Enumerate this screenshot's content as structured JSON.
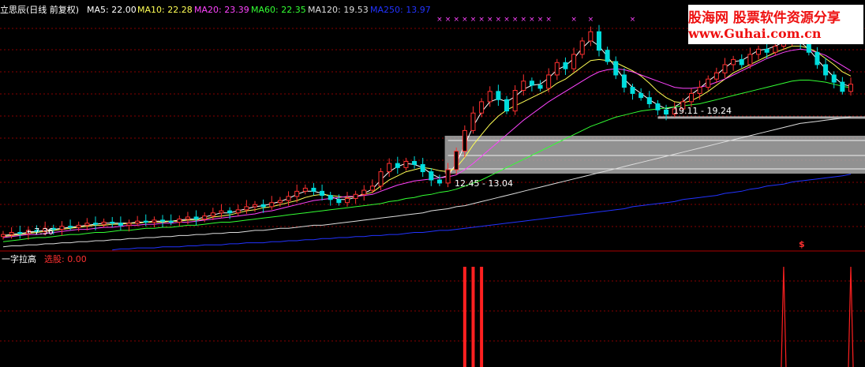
{
  "header": {
    "stock_name": "立思辰(日线 前复权)",
    "ma_labels": [
      {
        "label": "MA5: 22.00",
        "color": "#ffffff"
      },
      {
        "label": "MA10: 22.28",
        "color": "#ffff55"
      },
      {
        "label": "MA20: 23.39",
        "color": "#ff44ff"
      },
      {
        "label": "MA60: 22.35",
        "color": "#33ff33"
      },
      {
        "label": "MA120: 19.53",
        "color": "#dddddd"
      },
      {
        "label": "MA250: 13.97",
        "color": "#2233ff"
      }
    ]
  },
  "annotations": {
    "price_low_label": "←7.36",
    "zone_label_1": "12.45 - 13.04",
    "zone_label_2": "19.11 - 19.24",
    "dollar_sign": "$"
  },
  "indicator_panel": {
    "name": "一字拉高",
    "metric_label": "选股: 0.00"
  },
  "watermark": {
    "line1": "股海网 股票软件资源分享",
    "line2": "www.Guhai.com.cn"
  },
  "colors": {
    "background": "#000000",
    "grid": "#880000",
    "up_candle": "#ff3030",
    "down_candle": "#00dddd",
    "signal_bar": "#ff2020",
    "ma5": "#ffffff",
    "ma10": "#ffff55",
    "ma20": "#ff44ff",
    "ma60": "#33ff33",
    "ma120": "#dddddd",
    "ma250": "#2233ff",
    "zone": "#aaaaaa",
    "marker": "#ff44ff"
  },
  "chart_data": {
    "type": "candlestick",
    "price_range": [
      6.5,
      29.5
    ],
    "close": [
      8.1,
      8.3,
      8.2,
      8.5,
      8.4,
      8.7,
      8.6,
      8.9,
      8.8,
      9.0,
      9.2,
      9.1,
      9.3,
      9.2,
      9.0,
      9.2,
      9.4,
      9.3,
      9.5,
      9.4,
      9.3,
      9.6,
      9.8,
      9.6,
      9.9,
      10.2,
      10.4,
      10.2,
      10.5,
      10.8,
      11.0,
      10.8,
      11.2,
      11.4,
      11.8,
      12.3,
      12.6,
      12.3,
      11.9,
      11.5,
      11.2,
      11.6,
      12.0,
      12.4,
      12.8,
      14.2,
      15.0,
      14.6,
      15.2,
      14.9,
      14.2,
      13.4,
      13.1,
      14.4,
      16.2,
      18.2,
      19.9,
      21.0,
      22.0,
      21.2,
      20.1,
      22.1,
      23.0,
      22.6,
      22.3,
      23.6,
      24.8,
      24.2,
      25.6,
      26.9,
      27.8,
      26.0,
      24.9,
      23.6,
      22.4,
      21.8,
      21.4,
      20.8,
      20.2,
      19.8,
      20.3,
      21.0,
      21.8,
      22.4,
      23.2,
      23.8,
      24.6,
      25.1,
      24.6,
      25.6,
      26.1,
      25.8,
      26.4,
      26.9,
      27.4,
      26.7,
      25.8,
      24.6,
      23.6,
      22.9,
      22.0,
      22.7
    ],
    "series": [
      {
        "name": "MA5",
        "color": "#ffffff",
        "values": [
          8.0,
          8.1,
          8.2,
          8.3,
          8.4,
          8.5,
          8.6,
          8.7,
          8.8,
          8.9,
          9.0,
          9.1,
          9.2,
          9.2,
          9.2,
          9.2,
          9.3,
          9.3,
          9.4,
          9.4,
          9.4,
          9.5,
          9.6,
          9.6,
          9.8,
          10.0,
          10.2,
          10.2,
          10.4,
          10.6,
          10.8,
          10.9,
          11.1,
          11.3,
          11.6,
          12.0,
          12.3,
          12.3,
          12.1,
          11.8,
          11.5,
          11.5,
          11.7,
          12.1,
          12.5,
          13.4,
          14.2,
          14.7,
          15.0,
          14.9,
          14.6,
          14.0,
          13.6,
          13.8,
          15.0,
          16.8,
          18.6,
          20.0,
          21.0,
          21.3,
          21.0,
          21.5,
          22.2,
          22.6,
          22.7,
          23.3,
          24.1,
          24.5,
          25.2,
          26.2,
          27.0,
          26.4,
          25.4,
          24.3,
          23.2,
          22.4,
          21.8,
          21.2,
          20.7,
          20.3,
          20.5,
          21.0,
          21.7,
          22.3,
          23.0,
          23.6,
          24.3,
          24.9,
          25.0,
          25.5,
          26.0,
          26.1,
          26.4,
          26.8,
          27.1,
          26.8,
          26.1,
          25.1,
          24.2,
          23.4,
          22.7,
          22.5
        ]
      },
      {
        "name": "MA10",
        "color": "#ffff55",
        "values": [
          7.9,
          8.0,
          8.1,
          8.2,
          8.3,
          8.4,
          8.5,
          8.6,
          8.7,
          8.8,
          8.9,
          9.0,
          9.0,
          9.1,
          9.1,
          9.2,
          9.2,
          9.3,
          9.3,
          9.3,
          9.4,
          9.4,
          9.5,
          9.5,
          9.6,
          9.8,
          9.9,
          10.0,
          10.2,
          10.4,
          10.5,
          10.7,
          10.8,
          11.0,
          11.2,
          11.4,
          11.7,
          11.9,
          12.0,
          11.9,
          11.8,
          11.7,
          11.8,
          12.0,
          12.2,
          12.8,
          13.4,
          13.8,
          14.2,
          14.4,
          14.6,
          14.5,
          14.3,
          14.2,
          14.6,
          15.6,
          16.8,
          17.8,
          18.8,
          19.6,
          20.2,
          20.6,
          21.0,
          21.4,
          21.8,
          22.2,
          22.8,
          23.2,
          23.8,
          24.4,
          25.0,
          25.1,
          25.0,
          24.8,
          24.4,
          24.0,
          23.5,
          22.8,
          22.0,
          21.4,
          21.0,
          20.9,
          21.1,
          21.5,
          22.0,
          22.6,
          23.2,
          23.8,
          24.2,
          24.6,
          25.0,
          25.4,
          25.8,
          26.1,
          26.4,
          26.4,
          26.2,
          25.8,
          25.2,
          24.6,
          23.9,
          23.5
        ]
      },
      {
        "name": "MA20",
        "color": "#ff44ff",
        "values": [
          7.8,
          7.9,
          8.0,
          8.1,
          8.1,
          8.2,
          8.3,
          8.4,
          8.5,
          8.6,
          8.6,
          8.7,
          8.8,
          8.8,
          8.9,
          9.0,
          9.0,
          9.1,
          9.1,
          9.2,
          9.2,
          9.3,
          9.3,
          9.4,
          9.5,
          9.6,
          9.7,
          9.8,
          9.9,
          10.0,
          10.1,
          10.3,
          10.4,
          10.6,
          10.8,
          11.0,
          11.2,
          11.4,
          11.5,
          11.6,
          11.7,
          11.8,
          11.8,
          11.9,
          12.0,
          12.3,
          12.6,
          12.9,
          13.1,
          13.3,
          13.4,
          13.5,
          13.6,
          13.7,
          13.9,
          14.4,
          15.0,
          15.7,
          16.4,
          17.1,
          17.8,
          18.5,
          19.2,
          19.8,
          20.4,
          21.0,
          21.5,
          22.0,
          22.5,
          23.0,
          23.5,
          23.9,
          24.1,
          24.2,
          24.1,
          23.9,
          23.6,
          23.3,
          23.0,
          22.7,
          22.4,
          22.3,
          22.3,
          22.4,
          22.6,
          22.9,
          23.2,
          23.6,
          24.0,
          24.4,
          24.8,
          25.2,
          25.5,
          25.8,
          26.0,
          26.1,
          26.0,
          25.8,
          25.5,
          25.0,
          24.5,
          24.0
        ]
      },
      {
        "name": "MA60",
        "color": "#33ff33",
        "values": [
          7.4,
          7.5,
          7.6,
          7.7,
          7.8,
          7.8,
          7.9,
          8.0,
          8.1,
          8.1,
          8.2,
          8.3,
          8.3,
          8.4,
          8.5,
          8.5,
          8.6,
          8.7,
          8.7,
          8.8,
          8.8,
          8.9,
          9.0,
          9.0,
          9.1,
          9.2,
          9.3,
          9.3,
          9.4,
          9.5,
          9.6,
          9.7,
          9.8,
          9.9,
          10.0,
          10.1,
          10.2,
          10.3,
          10.4,
          10.5,
          10.6,
          10.7,
          10.8,
          10.9,
          11.0,
          11.1,
          11.3,
          11.4,
          11.6,
          11.7,
          11.9,
          12.0,
          12.2,
          12.3,
          12.5,
          12.8,
          13.1,
          13.4,
          13.8,
          14.2,
          14.6,
          15.0,
          15.4,
          15.8,
          16.2,
          16.6,
          17.0,
          17.4,
          17.8,
          18.2,
          18.6,
          18.9,
          19.2,
          19.5,
          19.7,
          19.9,
          20.1,
          20.2,
          20.3,
          20.4,
          20.5,
          20.6,
          20.7,
          20.8,
          21.0,
          21.2,
          21.4,
          21.6,
          21.8,
          22.0,
          22.2,
          22.4,
          22.6,
          22.8,
          23.0,
          23.1,
          23.1,
          23.0,
          22.9,
          22.7,
          22.5,
          22.35
        ]
      },
      {
        "name": "MA120",
        "color": "#dddddd",
        "values": [
          6.9,
          7.0,
          7.0,
          7.1,
          7.1,
          7.2,
          7.2,
          7.3,
          7.3,
          7.4,
          7.4,
          7.5,
          7.5,
          7.6,
          7.6,
          7.7,
          7.7,
          7.8,
          7.8,
          7.9,
          7.9,
          8.0,
          8.0,
          8.1,
          8.1,
          8.2,
          8.2,
          8.3,
          8.3,
          8.4,
          8.5,
          8.5,
          8.6,
          8.7,
          8.7,
          8.8,
          8.9,
          9.0,
          9.0,
          9.1,
          9.2,
          9.3,
          9.4,
          9.5,
          9.6,
          9.7,
          9.8,
          9.9,
          10.0,
          10.1,
          10.2,
          10.4,
          10.5,
          10.6,
          10.8,
          10.9,
          11.1,
          11.3,
          11.5,
          11.7,
          11.9,
          12.1,
          12.3,
          12.5,
          12.7,
          12.9,
          13.1,
          13.3,
          13.5,
          13.7,
          13.9,
          14.1,
          14.3,
          14.5,
          14.7,
          14.9,
          15.1,
          15.3,
          15.5,
          15.7,
          15.9,
          16.1,
          16.3,
          16.5,
          16.7,
          16.9,
          17.1,
          17.3,
          17.5,
          17.7,
          17.9,
          18.1,
          18.3,
          18.5,
          18.7,
          18.9,
          19.0,
          19.1,
          19.2,
          19.3,
          19.4,
          19.53
        ]
      },
      {
        "name": "MA250",
        "color": "#2233ff",
        "values": [
          null,
          null,
          null,
          null,
          null,
          null,
          null,
          null,
          null,
          null,
          null,
          null,
          null,
          6.6,
          6.7,
          6.7,
          6.8,
          6.8,
          6.8,
          6.9,
          6.9,
          6.9,
          7.0,
          7.0,
          7.1,
          7.1,
          7.1,
          7.2,
          7.2,
          7.3,
          7.3,
          7.3,
          7.4,
          7.4,
          7.5,
          7.5,
          7.6,
          7.6,
          7.7,
          7.7,
          7.8,
          7.8,
          7.9,
          7.9,
          8.0,
          8.0,
          8.1,
          8.1,
          8.2,
          8.3,
          8.3,
          8.4,
          8.5,
          8.5,
          8.6,
          8.7,
          8.8,
          8.9,
          9.0,
          9.1,
          9.2,
          9.3,
          9.4,
          9.5,
          9.6,
          9.7,
          9.8,
          9.9,
          10.0,
          10.1,
          10.2,
          10.3,
          10.4,
          10.5,
          10.6,
          10.8,
          10.9,
          11.0,
          11.1,
          11.2,
          11.3,
          11.5,
          11.6,
          11.7,
          11.8,
          11.9,
          12.1,
          12.2,
          12.3,
          12.5,
          12.6,
          12.8,
          12.9,
          13.0,
          13.2,
          13.3,
          13.4,
          13.5,
          13.6,
          13.7,
          13.8,
          13.97
        ]
      }
    ],
    "zones": [
      {
        "low": 12.45,
        "high": 13.04
      },
      {
        "low": 19.11,
        "high": 19.24
      }
    ],
    "signal_bars": [
      55,
      56,
      57,
      93,
      101
    ],
    "marker_rows": [
      52,
      53,
      54,
      55,
      56,
      57,
      58,
      59,
      60,
      61,
      62,
      63,
      64,
      65,
      68,
      70,
      75,
      89,
      91
    ]
  }
}
